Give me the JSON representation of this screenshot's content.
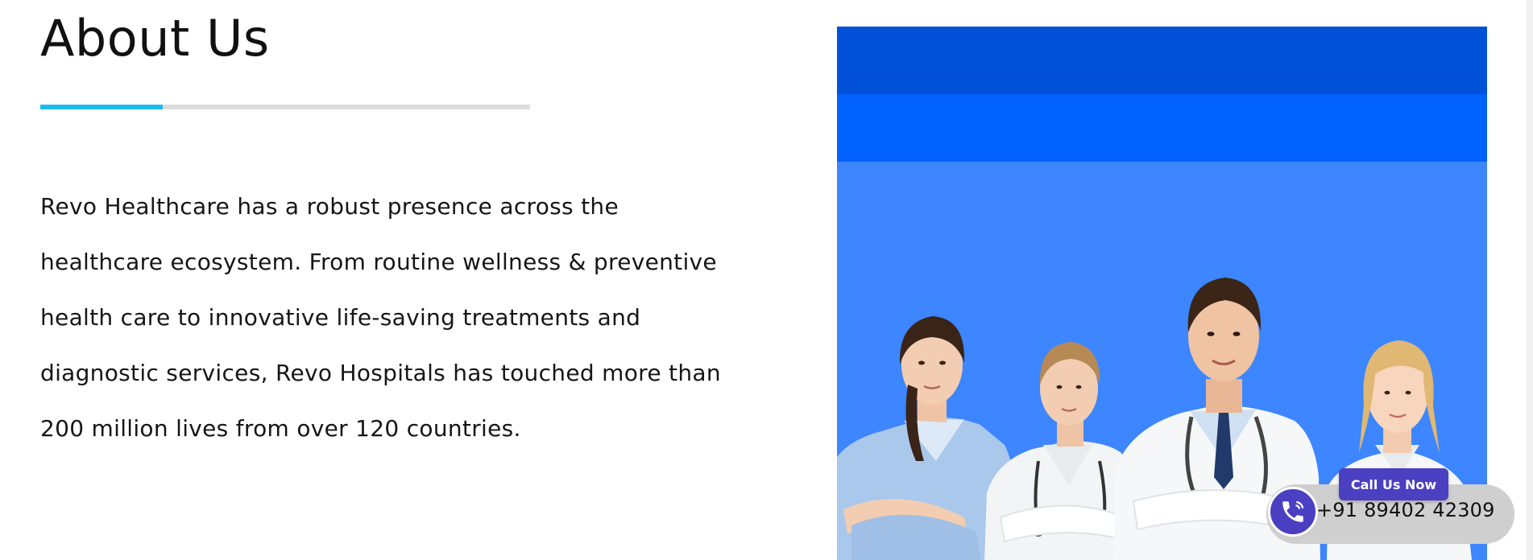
{
  "section": {
    "title": "About Us",
    "divider_progress": 0.25,
    "body": "Revo Healthcare has a robust presence across the healthcare ecosystem. From routine wellness & preventive health care to innovative life-saving treatments and diagnostic services, Revo Hospitals has touched more than 200 million lives from over 120 countries."
  },
  "image": {
    "icon": "doctors-photo"
  },
  "call_widget": {
    "button_label": "Call Us Now",
    "phone": "+91 89402 42309",
    "icon": "phone-icon",
    "accent_color": "#4b3fc2"
  },
  "colors": {
    "accent": "#1ebbee",
    "panel_dark": "#0051d8",
    "panel_mid": "#0061ff",
    "panel_light": "#3d86ff"
  }
}
